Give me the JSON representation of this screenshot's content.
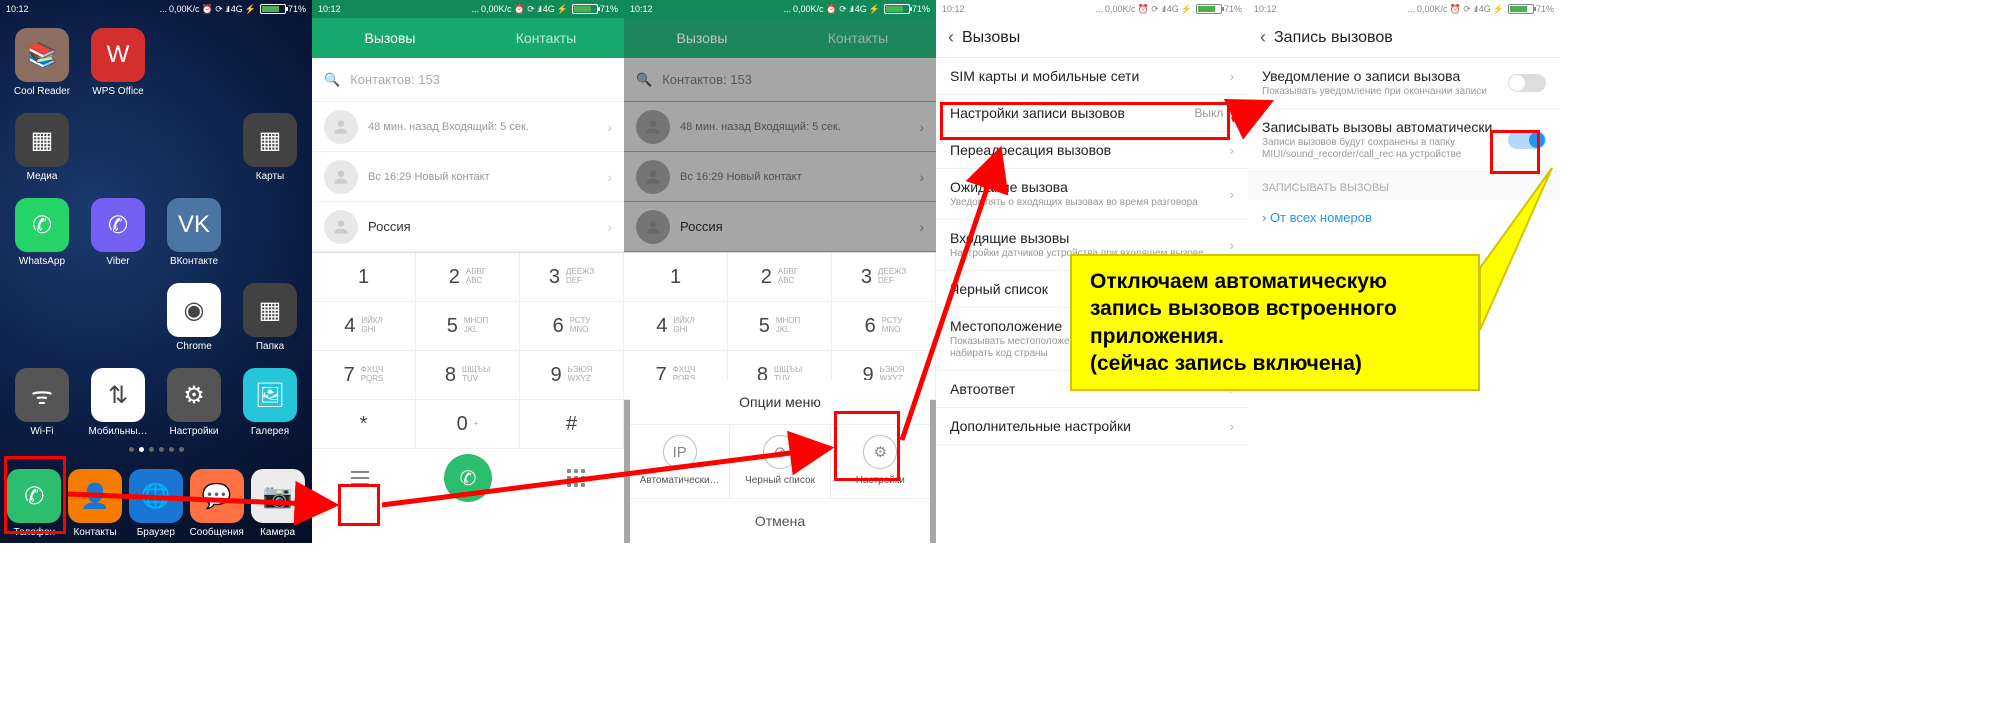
{
  "status": {
    "time": "10:12",
    "net": "0,00K/с",
    "sig": "4G",
    "batt": "71%"
  },
  "home": {
    "apps": [
      {
        "label": "Cool Reader",
        "ic": "📚",
        "bg": "#8d6e63"
      },
      {
        "label": "WPS Office",
        "ic": "W",
        "bg": "#d32f2f"
      },
      {
        "label": "",
        "ic": "",
        "bg": ""
      },
      {
        "label": "",
        "ic": "",
        "bg": ""
      },
      {
        "label": "Медиа",
        "ic": "▦",
        "bg": "#424242"
      },
      {
        "label": "",
        "ic": "",
        "bg": ""
      },
      {
        "label": "",
        "ic": "",
        "bg": ""
      },
      {
        "label": "Карты",
        "ic": "▦",
        "bg": "#424242"
      },
      {
        "label": "WhatsApp",
        "ic": "✆",
        "bg": "#25D366"
      },
      {
        "label": "Viber",
        "ic": "✆",
        "bg": "#7360f2"
      },
      {
        "label": "ВКонтакте",
        "ic": "VK",
        "bg": "#4c75a3"
      },
      {
        "label": "",
        "ic": "",
        "bg": ""
      },
      {
        "label": "",
        "ic": "",
        "bg": ""
      },
      {
        "label": "",
        "ic": "",
        "bg": ""
      },
      {
        "label": "Chrome",
        "ic": "◉",
        "bg": "#fff"
      },
      {
        "label": "Папка",
        "ic": "▦",
        "bg": "#424242"
      },
      {
        "label": "Wi-Fi",
        "ic": "ᯤ",
        "bg": "#555"
      },
      {
        "label": "Мобильны…",
        "ic": "⇅",
        "bg": "#fff"
      },
      {
        "label": "Настройки",
        "ic": "⚙",
        "bg": "#555"
      },
      {
        "label": "Галерея",
        "ic": "🖼",
        "bg": "#26c6da"
      }
    ],
    "dock": [
      {
        "label": "Телефон",
        "ic": "✆",
        "bg": "#2dbd6e"
      },
      {
        "label": "Контакты",
        "ic": "👤",
        "bg": "#f57c00"
      },
      {
        "label": "Браузер",
        "ic": "🌐",
        "bg": "#1976d2"
      },
      {
        "label": "Сообщения",
        "ic": "💬",
        "bg": "#ff7043"
      },
      {
        "label": "Камера",
        "ic": "📷",
        "bg": "#ececec"
      }
    ]
  },
  "phone": {
    "tabs": [
      "Вызовы",
      "Контакты"
    ],
    "search_ph": "Контактов: 153",
    "calls": [
      {
        "l1": "",
        "l2": "48 мин. назад Входящий: 5 сек."
      },
      {
        "l1": "",
        "l2": "Вс 16:29 Новый контакт"
      },
      {
        "l1": "Россия",
        "l2": ""
      }
    ],
    "keys": [
      {
        "n": "1",
        "t1": "",
        "t2": ""
      },
      {
        "n": "2",
        "t1": "АБВГ",
        "t2": "ABC"
      },
      {
        "n": "3",
        "t1": "ДЕЁЖЗ",
        "t2": "DEF"
      },
      {
        "n": "4",
        "t1": "ИЙКЛ",
        "t2": "GHI"
      },
      {
        "n": "5",
        "t1": "МНОП",
        "t2": "JKL"
      },
      {
        "n": "6",
        "t1": "РСТУ",
        "t2": "MNO"
      },
      {
        "n": "7",
        "t1": "ФХЦЧ",
        "t2": "PQRS"
      },
      {
        "n": "8",
        "t1": "ШЩЪЫ",
        "t2": "TUV"
      },
      {
        "n": "9",
        "t1": "ЬЭЮЯ",
        "t2": "WXYZ"
      },
      {
        "n": "*",
        "t1": "",
        "t2": ""
      },
      {
        "n": "0",
        "t1": "",
        "t2": "+"
      },
      {
        "n": "#",
        "t1": "",
        "t2": ""
      }
    ]
  },
  "sheet": {
    "title": "Опции меню",
    "items": [
      {
        "ic": "IP",
        "label": "Автоматически…"
      },
      {
        "ic": "⊘",
        "label": "Черный список"
      },
      {
        "ic": "⚙",
        "label": "Настройки"
      }
    ],
    "cancel": "Отмена"
  },
  "settings4": {
    "title": "Вызовы",
    "items": [
      {
        "l1": "SIM карты и мобильные сети",
        "l2": "",
        "val": ""
      },
      {
        "l1": "Настройки записи вызовов",
        "l2": "",
        "val": "Выкл"
      },
      {
        "l1": "Переадресация вызовов",
        "l2": "",
        "val": ""
      },
      {
        "l1": "Ожидание вызова",
        "l2": "Уведомлять о входящих вызовах во время разговора",
        "val": ""
      },
      {
        "l1": "Входящие вызовы",
        "l2": "Настройки датчиков устройства при входящем вызове",
        "val": ""
      },
      {
        "l1": "Черный список",
        "l2": "",
        "val": ""
      },
      {
        "l1": "Местоположение",
        "l2": "Показывать местоположение, чтобы вам не пришлось набирать код страны",
        "val": ""
      },
      {
        "l1": "Автоответ",
        "l2": "",
        "val": ""
      },
      {
        "l1": "Дополнительные настройки",
        "l2": "",
        "val": ""
      }
    ]
  },
  "settings5": {
    "title": "Запись вызовов",
    "items": [
      {
        "l1": "Уведомление о записи вызова",
        "l2": "Показывать уведомление при окончании записи",
        "toggle": "off"
      },
      {
        "l1": "Записывать вызовы автоматически",
        "l2": "Записи вызовов будут сохранены в папку MIUI/sound_recorder/call_rec на устройстве",
        "toggle": "on"
      }
    ],
    "section": "ЗАПИСЫВАТЬ ВЫЗОВЫ",
    "link": "От всех номеров"
  },
  "callout": "Отключаем автоматическую запись вызовов встроенного приложения.\n(сейчас запись включена)"
}
